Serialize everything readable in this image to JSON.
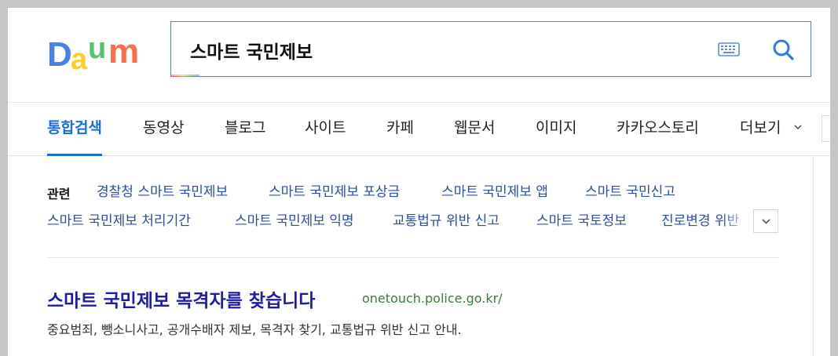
{
  "logo": {
    "text": "Daum",
    "colors": [
      "#4a7ff0",
      "#ffcd2a",
      "#55c36b",
      "#ff6b4e"
    ]
  },
  "search": {
    "query": "스마트 국민제보",
    "keyboard_icon": "keyboard-icon",
    "search_icon": "search-icon"
  },
  "tabs": [
    {
      "label": "통합검색",
      "active": true
    },
    {
      "label": "동영상"
    },
    {
      "label": "블로그"
    },
    {
      "label": "사이트"
    },
    {
      "label": "카페"
    },
    {
      "label": "웹문서"
    },
    {
      "label": "이미지"
    },
    {
      "label": "카카오스토리"
    },
    {
      "label": "더보기"
    }
  ],
  "related": {
    "label": "관련",
    "row1": [
      "경찰청 스마트 국민제보",
      "스마트 국민제보 포상금",
      "스마트 국민제보 앱",
      "스마트 국민신고"
    ],
    "row2": [
      "스마트 국민제보 처리기간",
      "스마트 국민제보 익명",
      "교통법규 위반 신고",
      "스마트 국토정보",
      "진로변경 위반"
    ]
  },
  "result": {
    "title": "스마트 국민제보 목격자를 찾습니다",
    "url": "onetouch.police.go.kr/",
    "description": "중요범죄, 뺑소니사고, 공개수배자 제보, 목격자 찾기, 교통법규 위반 신고 안내."
  },
  "colors": {
    "accent_blue": "#1a6ed8",
    "link_blue": "#2a4ea6",
    "title_blue": "#1f1ba8",
    "url_green": "#3b7d3b"
  }
}
